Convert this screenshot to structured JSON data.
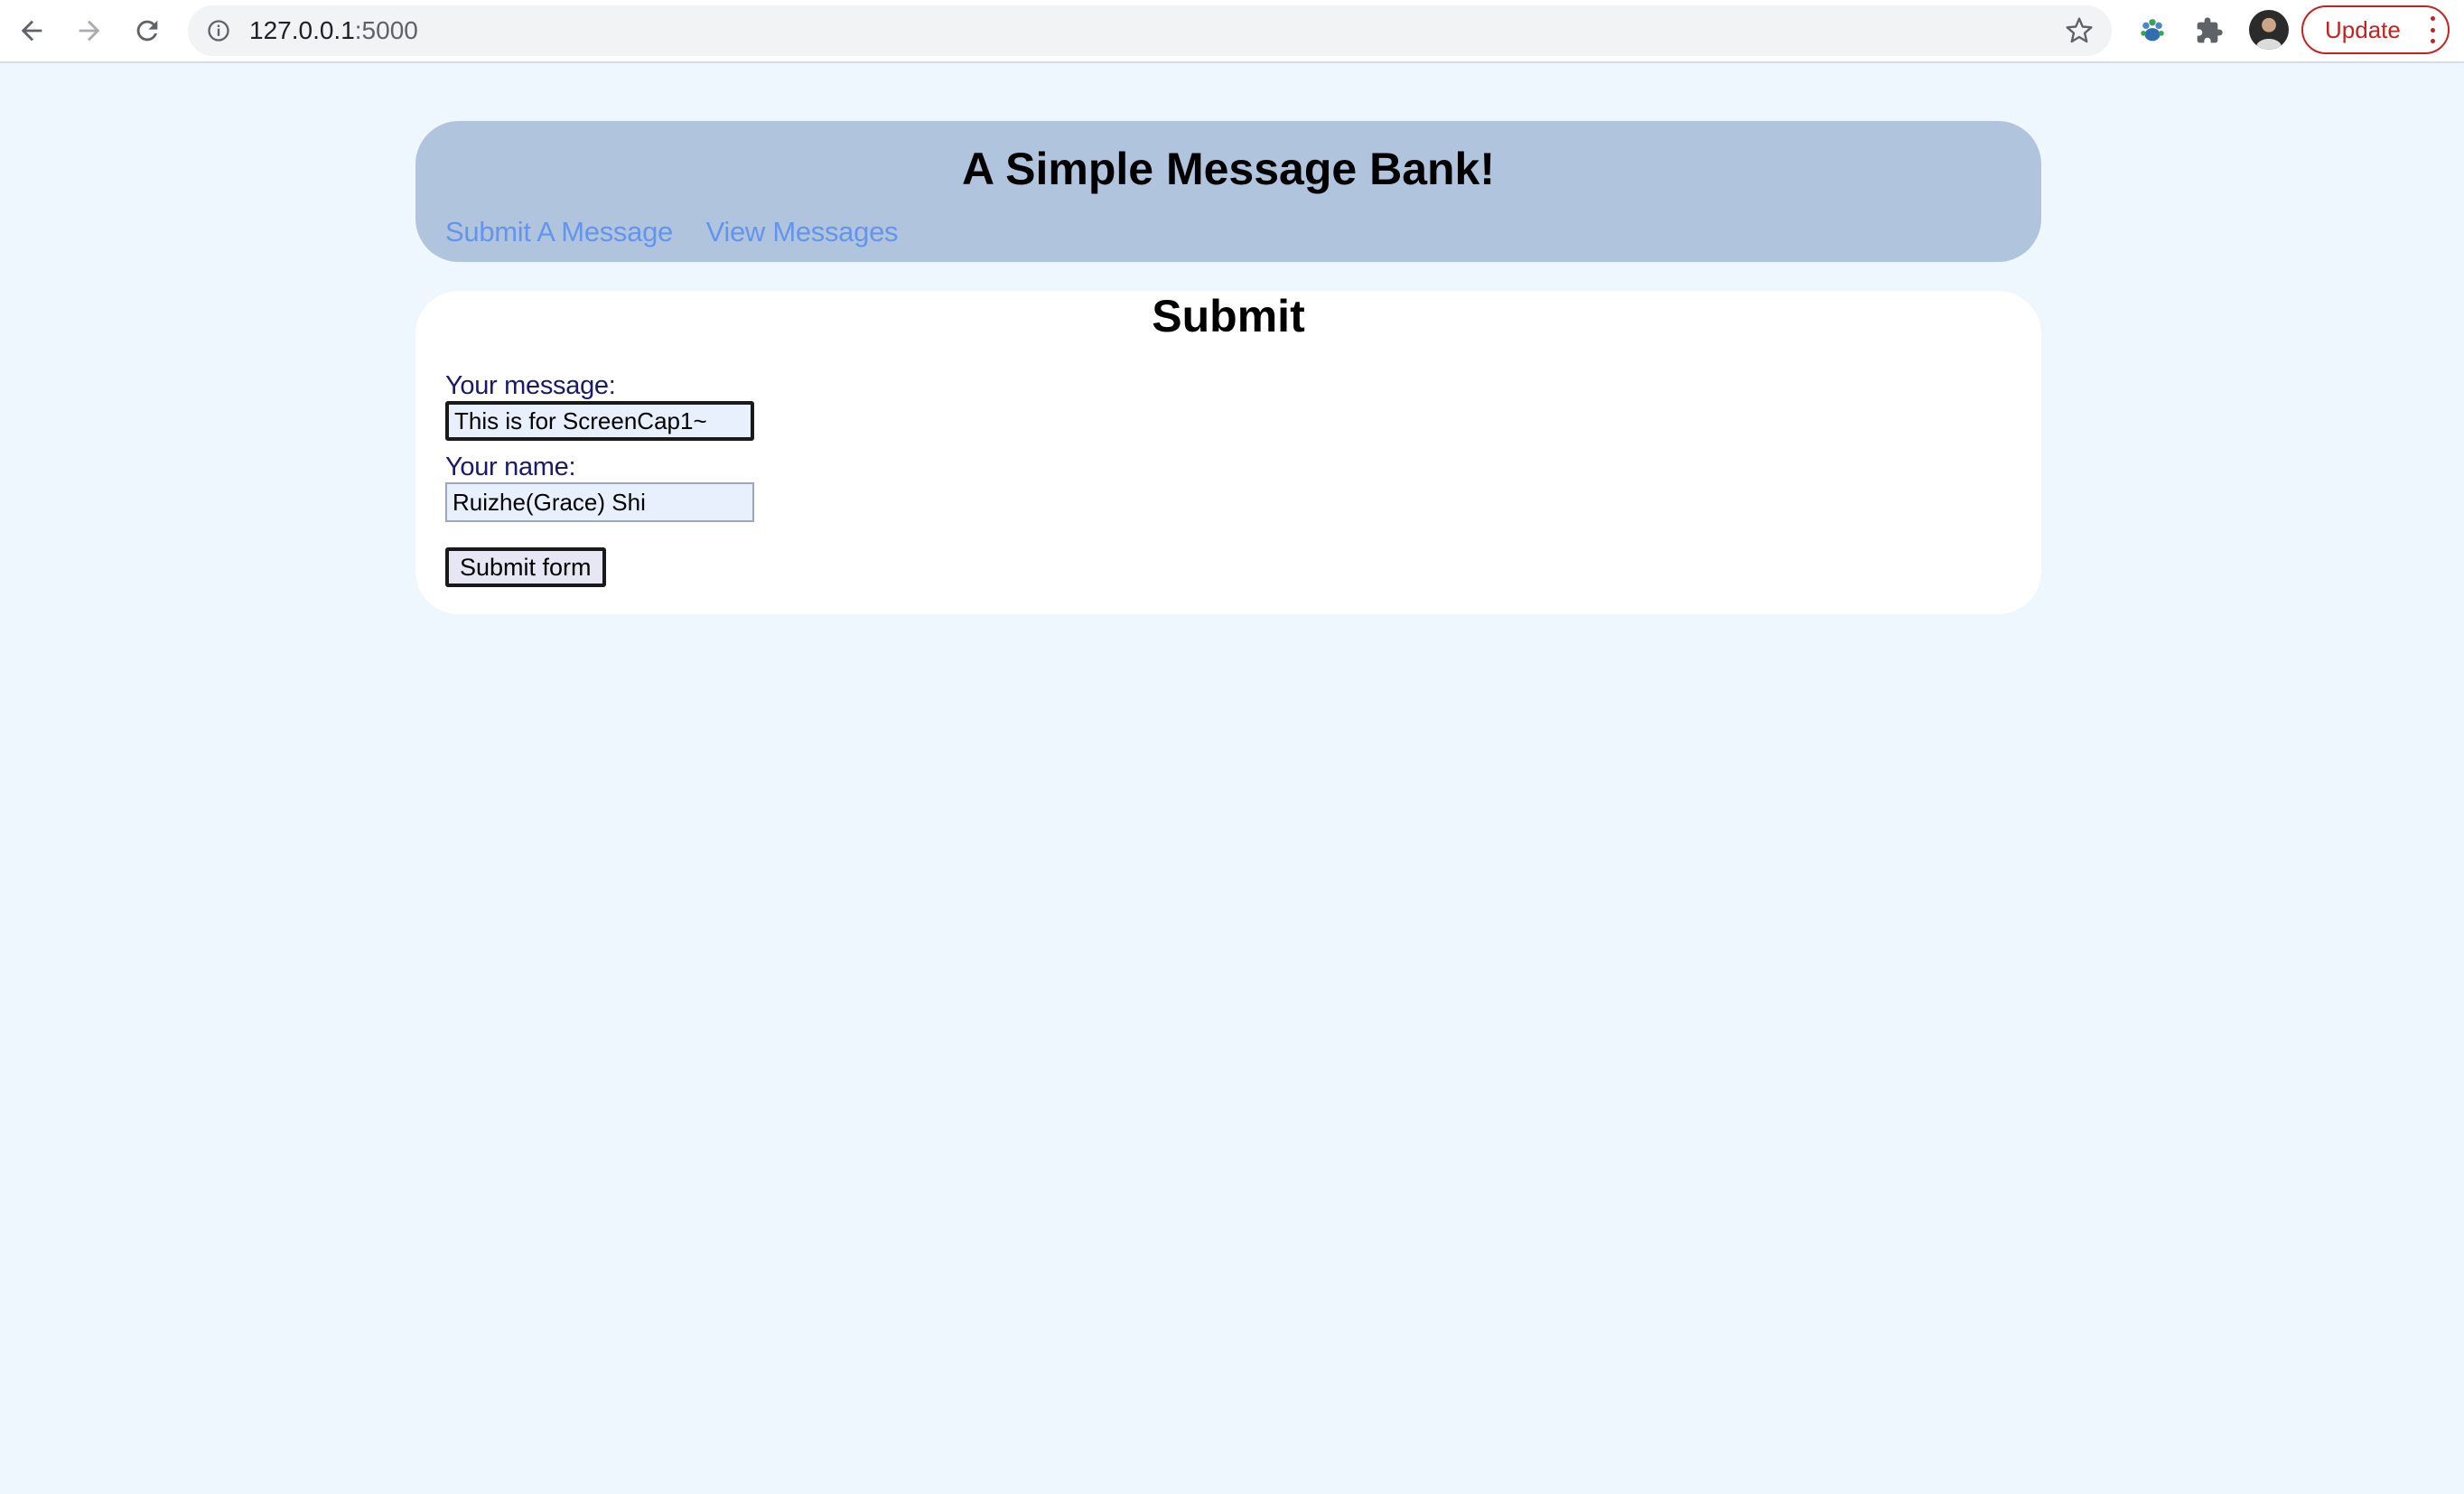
{
  "browser": {
    "url_host": "127.0.0.1",
    "url_port": ":5000",
    "update_label": "Update"
  },
  "header": {
    "title": "A Simple Message Bank!",
    "nav": [
      {
        "label": "Submit A Message"
      },
      {
        "label": "View Messages"
      }
    ]
  },
  "main": {
    "heading": "Submit",
    "form": {
      "message_label": "Your message:",
      "message_value": "This is for ScreenCap1~",
      "name_label": "Your name:",
      "name_value": "Ruizhe(Grace) Shi",
      "submit_label": "Submit form"
    }
  },
  "colors": {
    "page_bg": "#eef6fe",
    "header_bg": "#b0c4de",
    "link": "#6495ed",
    "label": "#191970",
    "input_bg": "#e8f0fe"
  }
}
